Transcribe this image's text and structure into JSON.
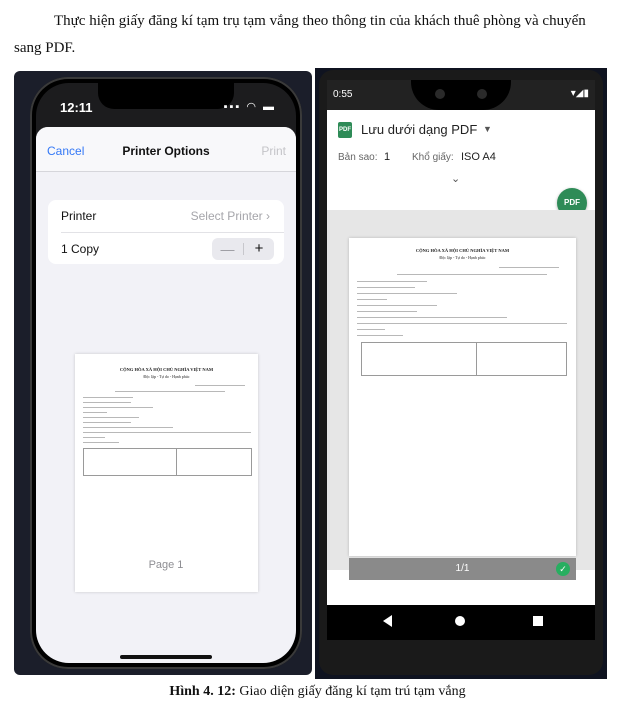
{
  "intro": {
    "line": "Thực hiện giấy đăng kí tạm trụ tạm vắng theo thông tin của khách thuê phòng và chuyển sang PDF."
  },
  "iphone": {
    "status_time": "12:11",
    "nav": {
      "cancel": "Cancel",
      "title": "Printer Options",
      "print": "Print"
    },
    "printer": {
      "label": "Printer",
      "value": "Select Printer",
      "chevron": "›"
    },
    "copies": {
      "label": "1 Copy",
      "minus": "—",
      "plus": "+"
    },
    "page_label": "Page 1",
    "icons": [
      "signal-icon",
      "wifi-icon",
      "battery-icon"
    ]
  },
  "document_preview": {
    "heading": "CỘNG HÒA XÃ HỘI CHỦ NGHĨA VIỆT NAM",
    "subheading": "Độc lập - Tự do - Hạnh phúc"
  },
  "android": {
    "status_time": "0:55",
    "destination": "Lưu dưới dạng PDF",
    "copies_label": "Bản sao:",
    "copies_value": "1",
    "paper_label": "Khổ giấy:",
    "paper_value": "ISO A4",
    "pdf_badge": "PDF",
    "page_indicator": "1/1",
    "colors": {
      "accent": "#2e8b57",
      "check": "#27ae60"
    },
    "icons": [
      "pdf-icon",
      "dropdown-caret-icon",
      "expand-chevron-icon",
      "save-pdf-fab-icon",
      "check-icon",
      "back-icon",
      "home-icon",
      "recents-icon"
    ]
  },
  "caption": {
    "label": "Hình 4. 12:",
    "text": " Giao diện giấy đăng kí tạm trú tạm vắng"
  }
}
